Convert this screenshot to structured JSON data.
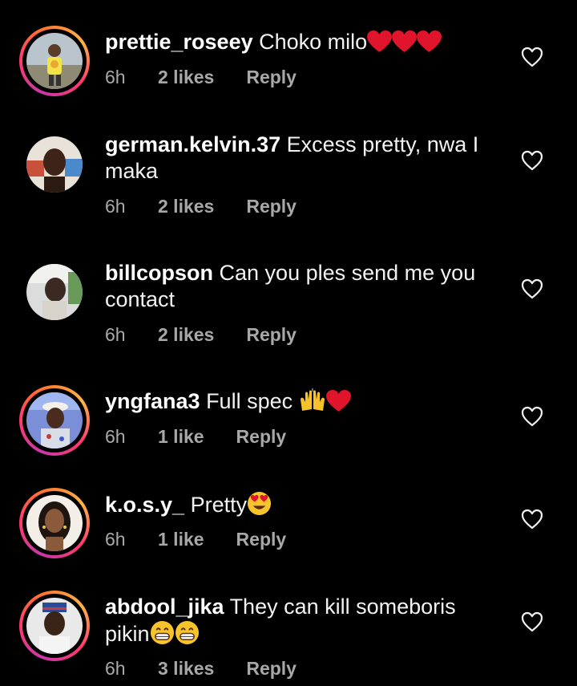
{
  "comments": [
    {
      "username": "prettie_roseey",
      "text": "Choko milo",
      "emoji_suffix": [
        "red-heart",
        "red-heart",
        "red-heart"
      ],
      "time": "6h",
      "likes": "2 likes",
      "reply_label": "Reply",
      "has_story_ring": true
    },
    {
      "username": "german.kelvin.37",
      "text": "Excess pretty, nwa I maka",
      "emoji_suffix": [],
      "time": "6h",
      "likes": "2 likes",
      "reply_label": "Reply",
      "has_story_ring": false
    },
    {
      "username": "billcopson",
      "text": "Can you ples send me you contact",
      "emoji_suffix": [],
      "time": "6h",
      "likes": "2 likes",
      "reply_label": "Reply",
      "has_story_ring": false
    },
    {
      "username": "yngfana3",
      "text": "Full spec ",
      "emoji_suffix": [
        "raising-hands",
        "red-heart"
      ],
      "time": "6h",
      "likes": "1 like",
      "reply_label": "Reply",
      "has_story_ring": true
    },
    {
      "username": "k.o.s.y_",
      "text": "Pretty",
      "emoji_suffix": [
        "heart-eyes"
      ],
      "time": "6h",
      "likes": "1 like",
      "reply_label": "Reply",
      "has_story_ring": true
    },
    {
      "username": "abdool_jika",
      "text": "They can kill someboris pikin",
      "emoji_suffix": [
        "grinning-face",
        "grinning-face"
      ],
      "time": "6h",
      "likes": "3 likes",
      "reply_label": "Reply",
      "has_story_ring": true
    }
  ],
  "colors": {
    "background": "#000000",
    "text": "#ffffff",
    "meta_text": "#a8a8a8",
    "heart_emoji": "#e0142a",
    "story_ring": [
      "#c837ab",
      "#ff3b6b",
      "#ff7a2b"
    ]
  }
}
